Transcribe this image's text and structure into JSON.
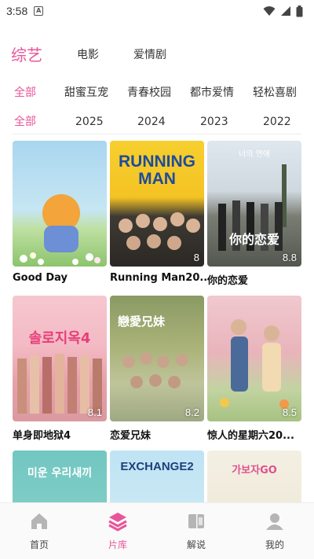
{
  "status_bar": {
    "time": "3:58",
    "notification_glyph": "A"
  },
  "categories": {
    "active_index": 0,
    "items": [
      "综艺",
      "电影",
      "爱情剧"
    ]
  },
  "genre_filters": [
    "全部",
    "甜蜜互宠",
    "青春校园",
    "都市爱情",
    "轻松喜剧"
  ],
  "year_filters": [
    "全部",
    "2025",
    "2024",
    "2023",
    "2022"
  ],
  "colors": {
    "accent": "#e8559a",
    "text": "#222222",
    "nav_inactive": "#b5b5b5"
  },
  "shows": [
    {
      "title": "Good Day",
      "rating": ""
    },
    {
      "title": "Running Man20...",
      "rating": "8",
      "poster_text": "RUNNING MAN"
    },
    {
      "title": "你的恋爱",
      "rating": "8.8",
      "poster_text": "你的恋爱",
      "poster_small_text": "너의 연애"
    },
    {
      "title": "单身即地狱4",
      "rating": "8.1",
      "poster_text": "솔로지옥4"
    },
    {
      "title": "恋爱兄妹",
      "rating": "8.2",
      "poster_text": "戀愛兄妹"
    },
    {
      "title": "惊人的星期六20...",
      "rating": "8.5"
    },
    {
      "title": "",
      "rating": "",
      "poster_text": "미운 우리새끼"
    },
    {
      "title": "",
      "rating": "",
      "poster_text": "EXCHANGE2"
    },
    {
      "title": "",
      "rating": "",
      "poster_text": "가보자GO"
    }
  ],
  "bottom_nav": [
    {
      "label": "首页",
      "icon": "home-icon"
    },
    {
      "label": "片库",
      "icon": "layers-icon"
    },
    {
      "label": "解说",
      "icon": "book-icon"
    },
    {
      "label": "我的",
      "icon": "person-icon"
    }
  ],
  "active_nav_index": 1
}
